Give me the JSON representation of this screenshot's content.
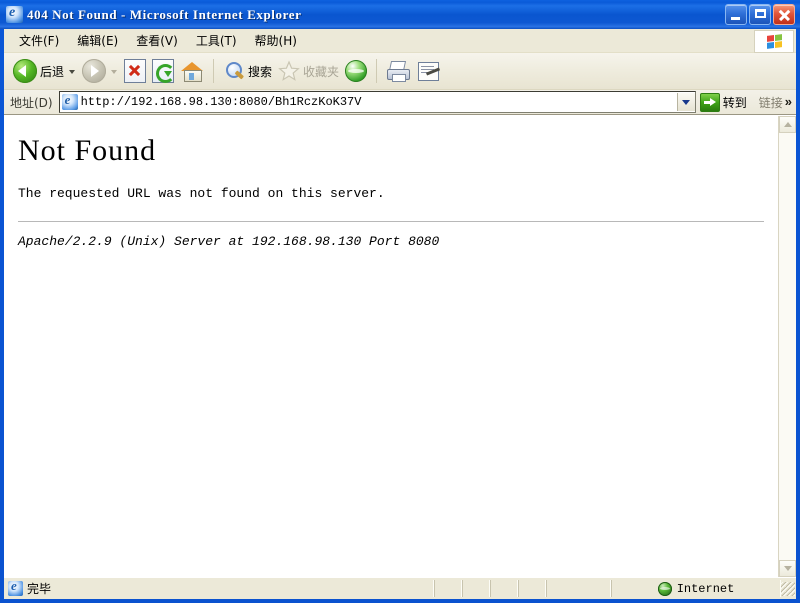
{
  "window": {
    "title": "404 Not Found - Microsoft Internet Explorer",
    "icon": "ie-page-icon",
    "controls": {
      "minimize": "minimize-button",
      "maximize": "maximize-button",
      "close": "close-button"
    }
  },
  "menu": {
    "items": [
      {
        "label": "文件(F)"
      },
      {
        "label": "编辑(E)"
      },
      {
        "label": "查看(V)"
      },
      {
        "label": "工具(T)"
      },
      {
        "label": "帮助(H)"
      }
    ],
    "logo": "windows-flag-logo"
  },
  "toolbar": {
    "back_label": "后退",
    "forward_label": "",
    "stop_label": "",
    "refresh_label": "",
    "home_label": "",
    "search_label": "搜索",
    "favorites_label": "收藏夹",
    "media_label": "",
    "print_label": "",
    "edit_label": ""
  },
  "address": {
    "label": "地址(D)",
    "url": "http://192.168.98.130:8080/Bh1RczKoK37V",
    "go_label": "转到",
    "links_label": "链接",
    "links_chevron": "»"
  },
  "page": {
    "heading": "Not Found",
    "message": "The requested URL was not found on this server.",
    "signature": "Apache/2.2.9 (Unix) Server at 192.168.98.130 Port 8080"
  },
  "statusbar": {
    "status_text": "完毕",
    "zone_text": "Internet"
  },
  "colors": {
    "titlebar_blue": "#0a56d6",
    "frame_blue": "#0a52cf",
    "chrome_beige": "#ece9d8",
    "page_background": "#ffffff",
    "close_button_red": "#e2563a",
    "go_button_green": "#3fa318"
  }
}
